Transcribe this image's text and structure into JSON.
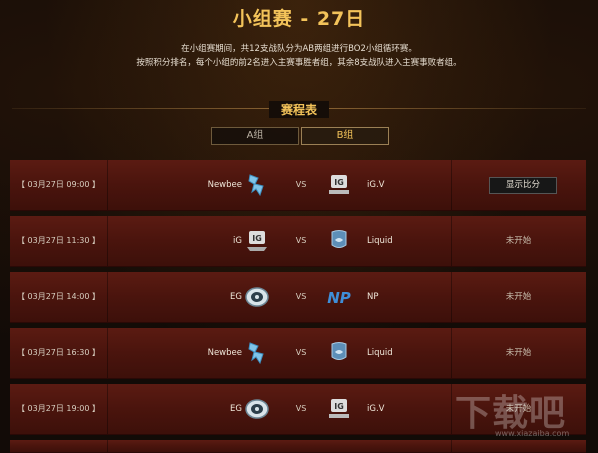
{
  "header": {
    "title": "小组赛 - 27日",
    "desc_line1": "在小组赛期间，共12支战队分为AB两组进行BO2小组循环赛。",
    "desc_line2": "按照积分排名，每个小组的前2名进入主赛事胜者组，其余8支战队进入主赛事败者组。"
  },
  "schedule": {
    "title": "赛程表",
    "tabs": [
      {
        "label": "A组",
        "active": false
      },
      {
        "label": "B组",
        "active": true
      }
    ]
  },
  "matches": [
    {
      "time": "【 03月27日 09:00 】",
      "team_left": "Newbee",
      "logo_left": "newbee-icon",
      "vs": "VS",
      "team_right": "iG.V",
      "logo_right": "ig-vitality-icon",
      "status": "",
      "button": "显示比分"
    },
    {
      "time": "【 03月27日 11:30 】",
      "team_left": "iG",
      "logo_left": "ig-icon",
      "vs": "VS",
      "team_right": "Liquid",
      "logo_right": "team-liquid-icon",
      "status": "未开始",
      "button": ""
    },
    {
      "time": "【 03月27日 14:00 】",
      "team_left": "EG",
      "logo_left": "eg-icon",
      "vs": "VS",
      "team_right": "NP",
      "logo_right": "np-icon",
      "status": "未开始",
      "button": ""
    },
    {
      "time": "【 03月27日 16:30 】",
      "team_left": "Newbee",
      "logo_left": "newbee-icon",
      "vs": "VS",
      "team_right": "Liquid",
      "logo_right": "team-liquid-icon",
      "status": "未开始",
      "button": ""
    },
    {
      "time": "【 03月27日 19:00 】",
      "team_left": "EG",
      "logo_left": "eg-icon",
      "vs": "VS",
      "team_right": "iG.V",
      "logo_right": "ig-vitality-icon",
      "status": "未开始",
      "button": ""
    }
  ],
  "watermark": {
    "text": "下载吧",
    "url": "www.xiazaiba.com"
  },
  "colors": {
    "accent_gold": "#f3c35a",
    "row_red": "#4a140d",
    "background": "#120b07"
  }
}
